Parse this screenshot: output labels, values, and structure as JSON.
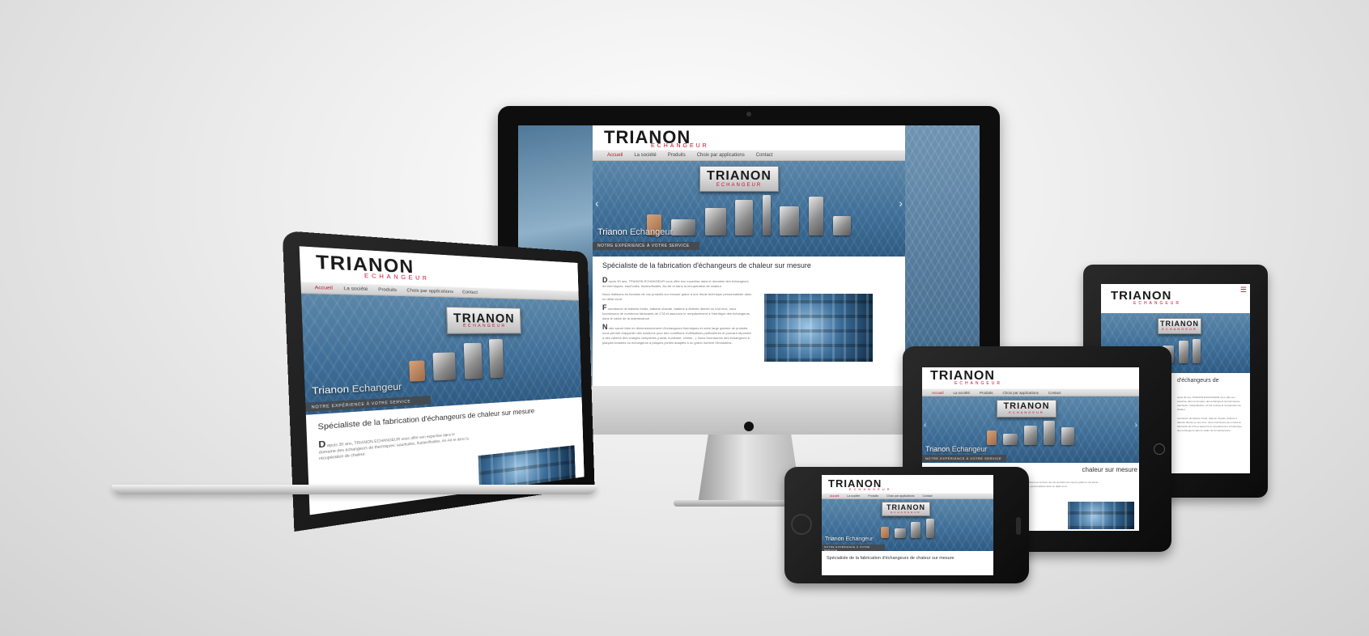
{
  "brand": {
    "logo_main": "TRIANON",
    "logo_sub": "ECHANGEUR"
  },
  "nav": {
    "items": [
      "Accueil",
      "La société",
      "Produits",
      "Choix par applications",
      "Contact"
    ]
  },
  "hero": {
    "caption_main": "Trianon",
    "caption_second": "Echangeur",
    "tagline": "NOTRE EXPÉRIENCE À VOTRE SERVICE"
  },
  "content": {
    "heading": "Spécialiste de la fabrication d'échangeurs de chaleur sur mesure",
    "tablet_heading_partial": "chaleur sur mesure",
    "ipad_heading_partial": "d'échangeurs de",
    "paragraphs": [
      {
        "initial": "D",
        "text": "epuis 30 ans, TRIANON ECHANGEUR vous offre son expertise dans le domaine des échangeurs de thermiques: eau/huiles, fluides/fluides, Air-Air et dans la récupération de chaleur."
      },
      {
        "initial": "",
        "text": "Nous réalisons en fonction de vos produits sur mesure grâce à une étude technique personnalisée dans un délai court."
      },
      {
        "initial": "F",
        "text": "ournisseur de batterie froide, batterie chaude, batterie à détente directe ou tout inox, nous fournissons de nombreux fabricants de CTA et assurons le remplacement à l'identique des échangeurs dans le cadre de la maintenance."
      },
      {
        "initial": "N",
        "text": "otre savoir faire en dimensionnement d'échangeurs thermiques et notre large gamme de produits nous permet d'apporter des solutions pour des conditions d'utilisations particulières et pouvant répondre à des cahiers des charges complexes (naval, nucléaire, chimie...). Nous fournissons des échangeurs à plaques brasées ou échangeurs à plaques jointes adaptés à un grand nombre d'industries."
      }
    ]
  },
  "icons": {
    "prev": "‹",
    "next": "›",
    "menu": "☰"
  },
  "colors": {
    "brand_red": "#c8102e",
    "hero_blue": "#3f6f98",
    "device_black": "#111111",
    "aluminium": "#c9c9c9"
  }
}
